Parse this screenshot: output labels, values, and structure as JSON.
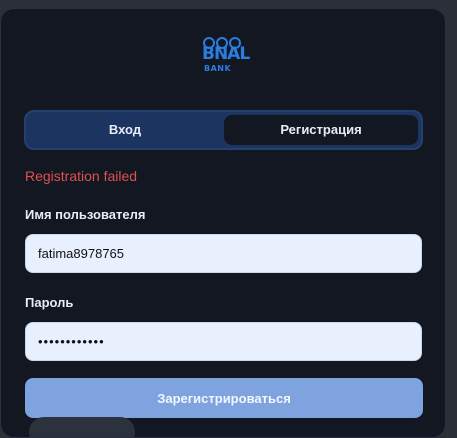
{
  "logo": {
    "brand": "BNAL",
    "sub": "BANK",
    "color": "#2a7de1"
  },
  "tabs": [
    {
      "label": "Вход",
      "active": false
    },
    {
      "label": "Регистрация",
      "active": true
    }
  ],
  "error": "Registration failed",
  "form": {
    "username_label": "Имя пользователя",
    "username_value": "fatima8978765",
    "password_label": "Пароль",
    "password_value": "••••••••••••",
    "submit_label": "Зарегистрироваться"
  },
  "colors": {
    "card_bg": "#121722",
    "tab_bar": "#1b3560",
    "error": "#e0504f",
    "input_bg": "#e8f0fe",
    "button": "#7ea3de"
  }
}
